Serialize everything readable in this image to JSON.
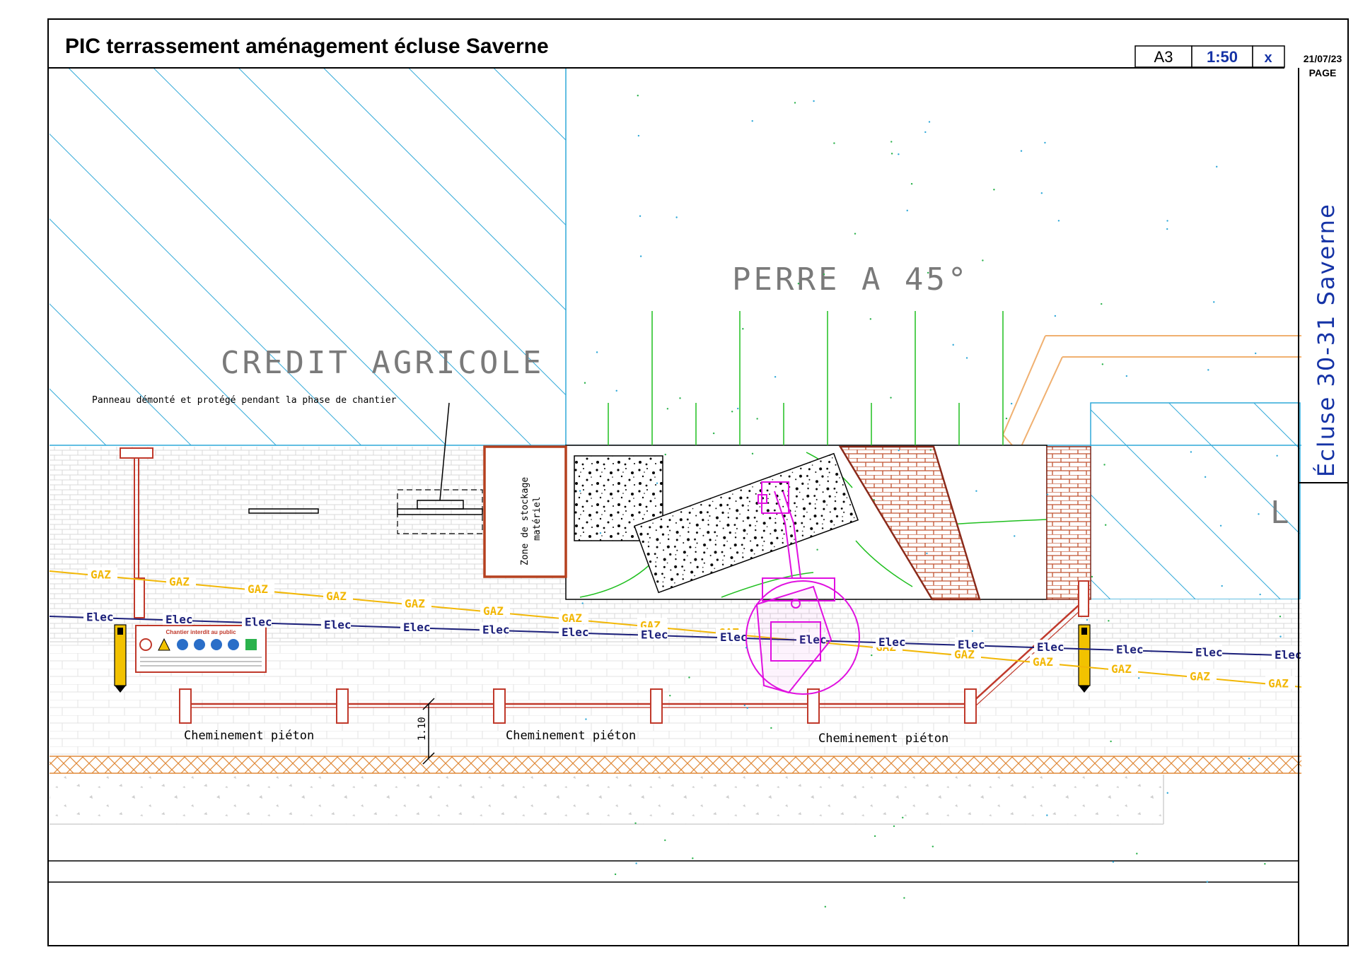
{
  "title": "PIC terrassement aménagement écluse Saverne",
  "title_block": {
    "format": "A3",
    "scale": "1:50",
    "sheet": "x",
    "date": "21/07/23",
    "page_label": "PAGE",
    "side_title": "Écluse 30-31 Saverne"
  },
  "labels": {
    "credit_agricole": "CREDIT AGRICOLE",
    "perre": "PERRE A 45°",
    "panneau_note": "Panneau démonté et protégé pendant la phase de chantier",
    "zone_stockage_line1": "Zone de stockage",
    "zone_stockage_line2": "matériel",
    "cheminement_1": "Cheminement piéton",
    "cheminement_2": "Cheminement piéton",
    "cheminement_3": "Cheminement piéton",
    "dimension": "1.10",
    "partial_right": "L",
    "sign_header": "Chantier interdit au public"
  },
  "networks": {
    "gaz": {
      "label": "GAZ",
      "color": "#f2b705"
    },
    "elec": {
      "label": "Elec",
      "color": "#1b1f7a"
    }
  },
  "colors": {
    "hatch_cyan": "#2fa8d8",
    "barrier_red": "#c0392b",
    "excavator_magenta": "#e010e0",
    "green": "#1fbf1f",
    "orange_hatch": "#e08a3a",
    "brick_red": "#b5462a"
  }
}
